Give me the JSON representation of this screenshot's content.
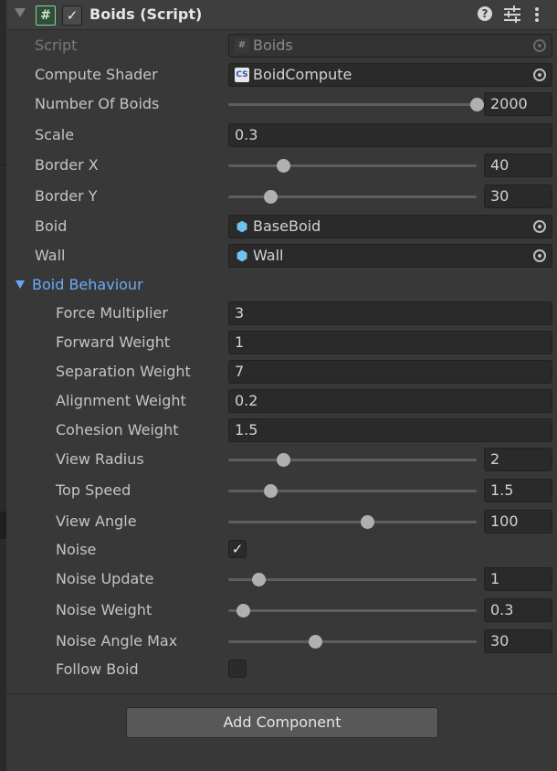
{
  "component": {
    "title": "Boids (Script)",
    "enabled": true,
    "icon": "cs-script-icon"
  },
  "fields": {
    "script": {
      "label": "Script",
      "value": "Boids",
      "icon": "cs-script-icon"
    },
    "compute_shader": {
      "label": "Compute Shader",
      "value": "BoidCompute",
      "icon": "compute-shader-icon"
    },
    "number_of_boids": {
      "label": "Number Of Boids",
      "value": "2000",
      "fraction": 1.0
    },
    "scale": {
      "label": "Scale",
      "value": "0.3"
    },
    "border_x": {
      "label": "Border X",
      "value": "40",
      "fraction": 0.22
    },
    "border_y": {
      "label": "Border Y",
      "value": "30",
      "fraction": 0.17
    },
    "boid": {
      "label": "Boid",
      "value": "BaseBoid",
      "icon": "prefab-cube-icon"
    },
    "wall": {
      "label": "Wall",
      "value": "Wall",
      "icon": "prefab-cube-icon"
    }
  },
  "behaviour": {
    "section_label": "Boid Behaviour",
    "expanded": true,
    "force_multiplier": {
      "label": "Force Multiplier",
      "value": "3"
    },
    "forward_weight": {
      "label": "Forward Weight",
      "value": "1"
    },
    "separation_weight": {
      "label": "Separation Weight",
      "value": "7"
    },
    "alignment_weight": {
      "label": "Alignment Weight",
      "value": "0.2"
    },
    "cohesion_weight": {
      "label": "Cohesion Weight",
      "value": "1.5"
    },
    "view_radius": {
      "label": "View Radius",
      "value": "2",
      "fraction": 0.22
    },
    "top_speed": {
      "label": "Top Speed",
      "value": "1.5",
      "fraction": 0.17
    },
    "view_angle": {
      "label": "View Angle",
      "value": "100",
      "fraction": 0.56
    },
    "noise": {
      "label": "Noise",
      "checked": true
    },
    "noise_update": {
      "label": "Noise Update",
      "value": "1",
      "fraction": 0.12
    },
    "noise_weight": {
      "label": "Noise Weight",
      "value": "0.3",
      "fraction": 0.06
    },
    "noise_angle_max": {
      "label": "Noise Angle Max",
      "value": "30",
      "fraction": 0.35
    },
    "follow_boid": {
      "label": "Follow Boid",
      "checked": false
    }
  },
  "add_component_label": "Add Component",
  "colors": {
    "panel_bg": "#383838",
    "header_bg": "#3e3e3e",
    "field_bg": "#2a2a2a",
    "section_accent": "#6cabf8",
    "prefab_icon": "#6fc3ef"
  }
}
